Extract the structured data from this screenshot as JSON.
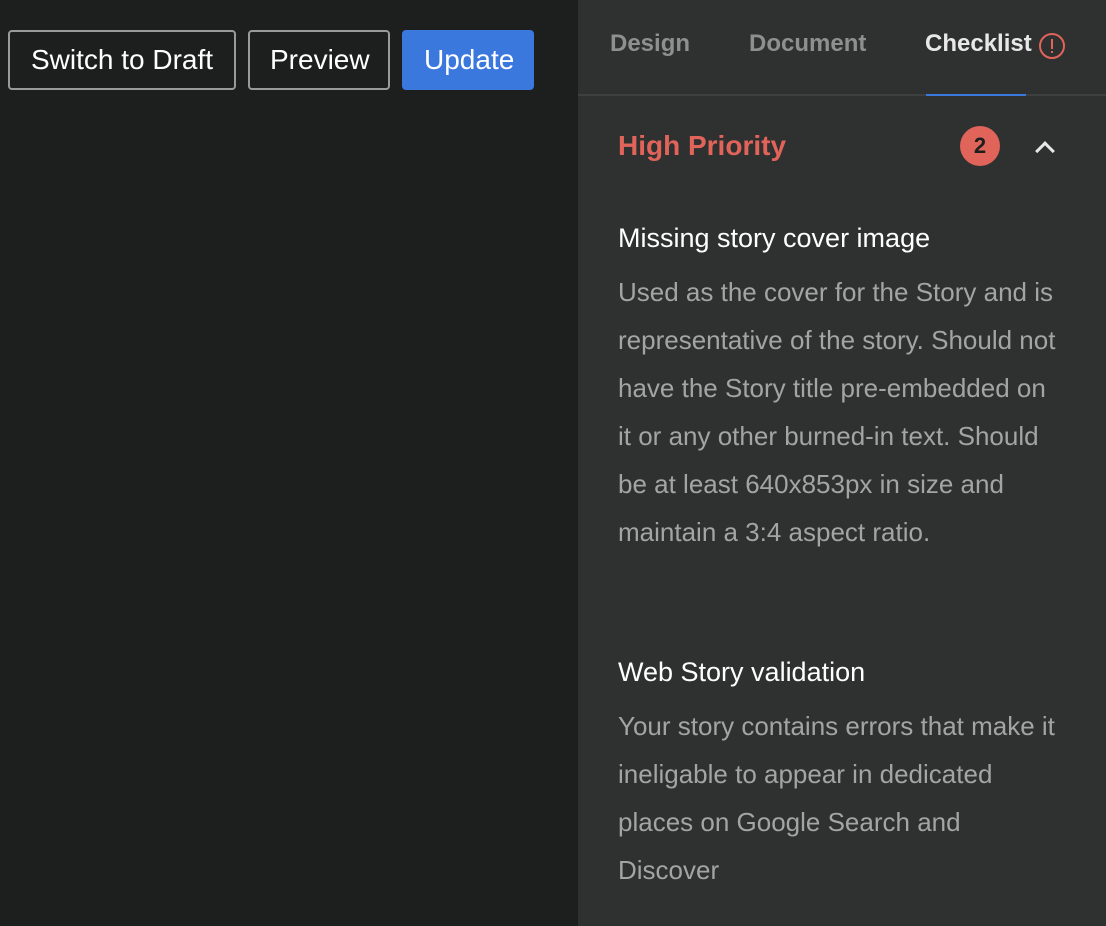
{
  "toolbar": {
    "switch_to_draft_label": "Switch to Draft",
    "preview_label": "Preview",
    "update_label": "Update"
  },
  "tabs": [
    {
      "label": "Design",
      "active": false
    },
    {
      "label": "Document",
      "active": false
    },
    {
      "label": "Checklist",
      "active": true,
      "icon": "alert-circle-icon"
    }
  ],
  "checklist": {
    "section": {
      "title": "High Priority",
      "count": "2",
      "expanded": true,
      "toggle_icon": "chevron-up-icon"
    },
    "issues": [
      {
        "title": "Missing story cover image",
        "description": "Used as the cover for the Story and is representative of the story. Should not have the Story title pre-embedded on it or any other burned-in text. Should be at least 640x853px in size and maintain a 3:4 aspect ratio."
      },
      {
        "title": "Web Story validation",
        "description": "Your story contains errors that make it ineligable to appear in dedicated places on Google Search and Discover"
      }
    ]
  },
  "colors": {
    "accent": "#3b78de",
    "priority_high": "#e0645a",
    "panel_bg": "#2f3030",
    "canvas_bg": "#1d1e1e"
  }
}
